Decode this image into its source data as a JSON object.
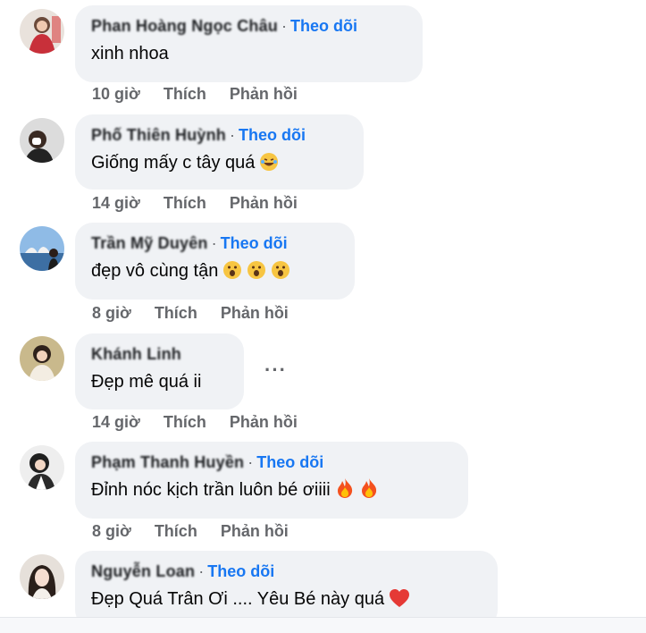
{
  "comments": [
    {
      "name": "Phan Hoàng Ngọc Châu",
      "follow": "Theo dõi",
      "text": "xinh nhoa",
      "time": "10 giờ",
      "like": "Thích",
      "reply": "Phản hồi",
      "emojis": []
    },
    {
      "name": "Phố Thiên Huỳnh",
      "follow": "Theo dõi",
      "text": "Giống mấy c tây quá",
      "time": "14 giờ",
      "like": "Thích",
      "reply": "Phản hồi",
      "emojis": [
        "laughing-tears"
      ]
    },
    {
      "name": "Trần Mỹ Duyên",
      "follow": "Theo dõi",
      "text": "đẹp vô cùng tận",
      "time": "8 giờ",
      "like": "Thích",
      "reply": "Phản hồi",
      "emojis": [
        "wow",
        "wow",
        "wow"
      ]
    },
    {
      "name": "Khánh Linh",
      "follow": "",
      "text": "Đẹp mê quá ii",
      "time": "14 giờ",
      "like": "Thích",
      "reply": "Phản hồi",
      "emojis": [],
      "more": "···"
    },
    {
      "name": "Phạm Thanh Huyền",
      "follow": "Theo dõi",
      "text": "Đỉnh nóc kịch trần luôn bé ơiiii",
      "time": "8 giờ",
      "like": "Thích",
      "reply": "Phản hồi",
      "emojis": [
        "fire",
        "fire"
      ]
    },
    {
      "name": "Nguyễn Loan",
      "follow": "Theo dõi",
      "text": "Đẹp Quá Trân Ơi .... Yêu Bé này quá",
      "time": "",
      "like": "",
      "reply": "",
      "emojis": [
        "red-heart"
      ]
    }
  ],
  "colors": {
    "bubble": "#f0f2f5",
    "link": "#1877f2",
    "meta": "#65676b"
  }
}
